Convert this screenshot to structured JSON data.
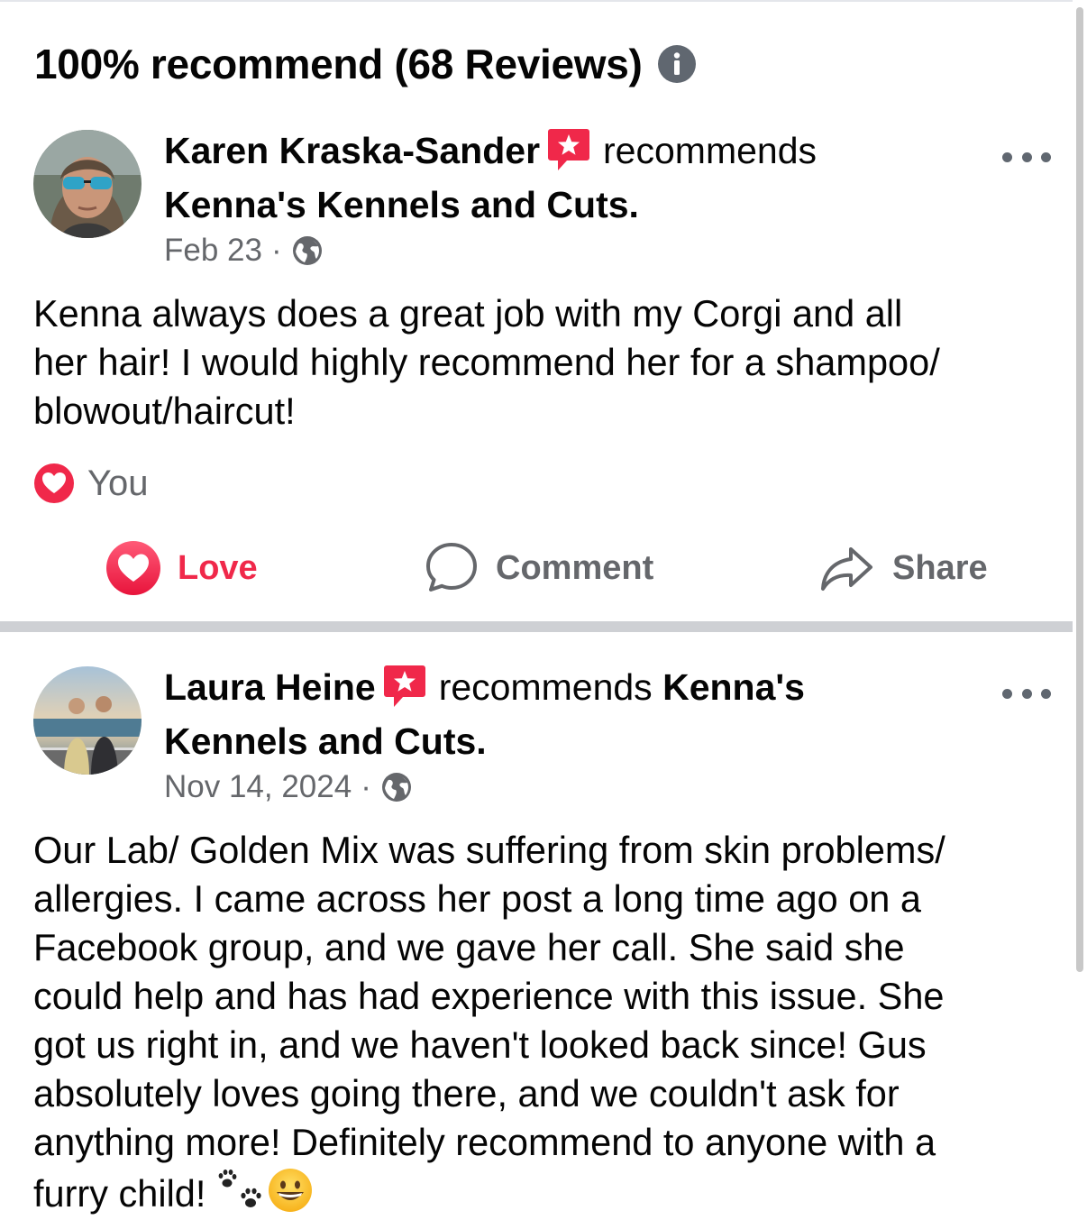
{
  "header": {
    "title": "100% recommend (68 Reviews)"
  },
  "colors": {
    "love": "#f0284a",
    "recommend_badge": "#f0284a",
    "secondary_text": "#65676b",
    "divider": "#ced0d4"
  },
  "reviews": [
    {
      "author": "Karen Kraska-Sander",
      "recommends_text": "recommends",
      "page_name": "Kenna's Kennels and Cuts.",
      "date": "Feb 23",
      "separator": "·",
      "privacy_icon": "globe-icon",
      "body": "Kenna always does a great job with my Corgi and all\nher hair!  I would highly recommend her for a shampoo/\nblowout/haircut!",
      "reaction_summary": "You",
      "reaction_icon": "love-heart-icon",
      "actions": {
        "love": "Love",
        "comment": "Comment",
        "share": "Share"
      }
    },
    {
      "author": "Laura Heine",
      "recommends_text": "recommends",
      "page_name_part1": "Kenna's",
      "page_name_part2": "Kennels and Cuts.",
      "date": "Nov 14, 2024",
      "separator": "·",
      "privacy_icon": "globe-icon",
      "body": "Our Lab/ Golden Mix was suffering from skin problems/\nallergies.  I came across her post a long time ago on a\nFacebook group, and we gave her call. She said she\ncould help and has had experience with this issue. She\ngot us right in, and we haven't looked back since! Gus\nabsolutely loves going there, and we couldn't ask for\nanything more! Definitely recommend to anyone with a\nfurry child!",
      "trailing_emoji": [
        "paw-prints-icon",
        "grinning-face-icon"
      ]
    }
  ]
}
